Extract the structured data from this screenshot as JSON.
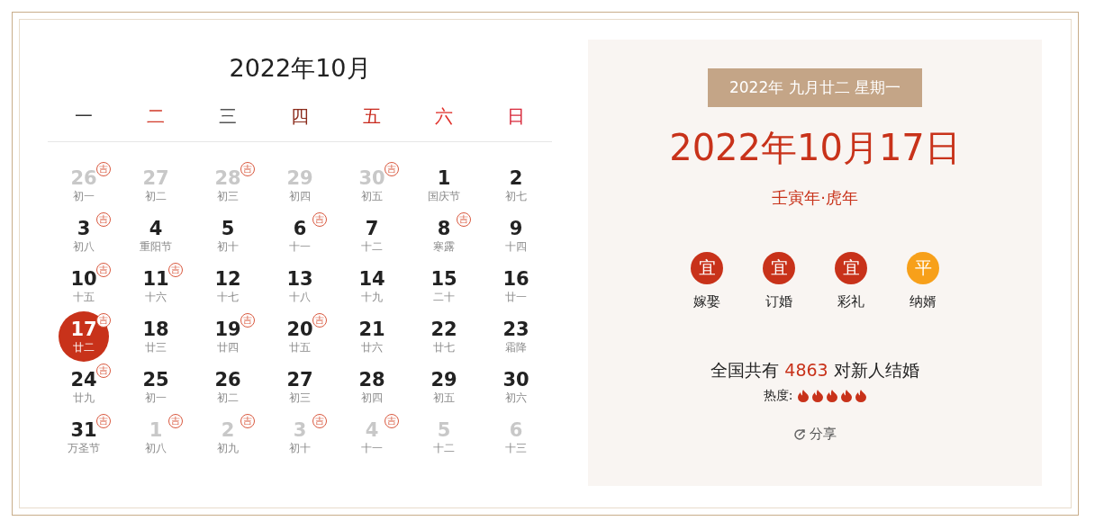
{
  "calendar": {
    "title": "2022年10月",
    "weekdays": [
      {
        "label": "一",
        "color": "#333333"
      },
      {
        "label": "二",
        "color": "#d23a2a"
      },
      {
        "label": "三",
        "color": "#555555"
      },
      {
        "label": "四",
        "color": "#8a2a1a"
      },
      {
        "label": "五",
        "color": "#c8281c"
      },
      {
        "label": "六",
        "color": "#e0302a"
      },
      {
        "label": "日",
        "color": "#d8283a"
      }
    ],
    "days": [
      {
        "day": "26",
        "lunar": "初一",
        "muted": true,
        "badge": "吉",
        "selected": false
      },
      {
        "day": "27",
        "lunar": "初二",
        "muted": true,
        "selected": false
      },
      {
        "day": "28",
        "lunar": "初三",
        "muted": true,
        "badge": "吉",
        "selected": false
      },
      {
        "day": "29",
        "lunar": "初四",
        "muted": true,
        "selected": false
      },
      {
        "day": "30",
        "lunar": "初五",
        "muted": true,
        "badge": "吉",
        "selected": false
      },
      {
        "day": "1",
        "lunar": "国庆节",
        "muted": false,
        "selected": false
      },
      {
        "day": "2",
        "lunar": "初七",
        "muted": false,
        "selected": false
      },
      {
        "day": "3",
        "lunar": "初八",
        "muted": false,
        "badge": "吉",
        "selected": false
      },
      {
        "day": "4",
        "lunar": "重阳节",
        "muted": false,
        "selected": false
      },
      {
        "day": "5",
        "lunar": "初十",
        "muted": false,
        "selected": false
      },
      {
        "day": "6",
        "lunar": "十一",
        "muted": false,
        "badge": "吉",
        "selected": false
      },
      {
        "day": "7",
        "lunar": "十二",
        "muted": false,
        "selected": false
      },
      {
        "day": "8",
        "lunar": "寒露",
        "muted": false,
        "badge": "吉",
        "selected": false
      },
      {
        "day": "9",
        "lunar": "十四",
        "muted": false,
        "selected": false
      },
      {
        "day": "10",
        "lunar": "十五",
        "muted": false,
        "badge": "吉",
        "selected": false
      },
      {
        "day": "11",
        "lunar": "十六",
        "muted": false,
        "badge": "吉",
        "selected": false
      },
      {
        "day": "12",
        "lunar": "十七",
        "muted": false,
        "selected": false
      },
      {
        "day": "13",
        "lunar": "十八",
        "muted": false,
        "selected": false
      },
      {
        "day": "14",
        "lunar": "十九",
        "muted": false,
        "selected": false
      },
      {
        "day": "15",
        "lunar": "二十",
        "muted": false,
        "selected": false
      },
      {
        "day": "16",
        "lunar": "廿一",
        "muted": false,
        "selected": false
      },
      {
        "day": "17",
        "lunar": "廿二",
        "muted": false,
        "badge": "吉",
        "selected": true
      },
      {
        "day": "18",
        "lunar": "廿三",
        "muted": false,
        "selected": false
      },
      {
        "day": "19",
        "lunar": "廿四",
        "muted": false,
        "badge": "吉",
        "selected": false
      },
      {
        "day": "20",
        "lunar": "廿五",
        "muted": false,
        "badge": "吉",
        "selected": false
      },
      {
        "day": "21",
        "lunar": "廿六",
        "muted": false,
        "selected": false
      },
      {
        "day": "22",
        "lunar": "廿七",
        "muted": false,
        "selected": false
      },
      {
        "day": "23",
        "lunar": "霜降",
        "muted": false,
        "selected": false
      },
      {
        "day": "24",
        "lunar": "廿九",
        "muted": false,
        "badge": "吉",
        "selected": false
      },
      {
        "day": "25",
        "lunar": "初一",
        "muted": false,
        "selected": false
      },
      {
        "day": "26",
        "lunar": "初二",
        "muted": false,
        "selected": false
      },
      {
        "day": "27",
        "lunar": "初三",
        "muted": false,
        "selected": false
      },
      {
        "day": "28",
        "lunar": "初四",
        "muted": false,
        "selected": false
      },
      {
        "day": "29",
        "lunar": "初五",
        "muted": false,
        "selected": false
      },
      {
        "day": "30",
        "lunar": "初六",
        "muted": false,
        "selected": false
      },
      {
        "day": "31",
        "lunar": "万圣节",
        "muted": false,
        "badge": "吉",
        "selected": false
      },
      {
        "day": "1",
        "lunar": "初八",
        "muted": true,
        "badge": "吉",
        "selected": false
      },
      {
        "day": "2",
        "lunar": "初九",
        "muted": true,
        "badge": "吉",
        "selected": false
      },
      {
        "day": "3",
        "lunar": "初十",
        "muted": true,
        "badge": "吉",
        "selected": false
      },
      {
        "day": "4",
        "lunar": "十一",
        "muted": true,
        "badge": "吉",
        "selected": false
      },
      {
        "day": "5",
        "lunar": "十二",
        "muted": true,
        "selected": false
      },
      {
        "day": "6",
        "lunar": "十三",
        "muted": true,
        "selected": false
      }
    ]
  },
  "detail": {
    "lunar_date": "2022年 九月廿二 星期一",
    "date": "2022年10月17日",
    "zodiac": "壬寅年·虎年",
    "activities": [
      {
        "mark": "宜",
        "label": "嫁娶",
        "kind": "good"
      },
      {
        "mark": "宜",
        "label": "订婚",
        "kind": "good"
      },
      {
        "mark": "宜",
        "label": "彩礼",
        "kind": "good"
      },
      {
        "mark": "平",
        "label": "纳婿",
        "kind": "neutral"
      }
    ],
    "count_prefix": "全国共有",
    "count": "4863",
    "count_suffix": "对新人结婚",
    "heat_label": "热度:",
    "heat": {
      "stars": 5
    },
    "share": "分享"
  }
}
